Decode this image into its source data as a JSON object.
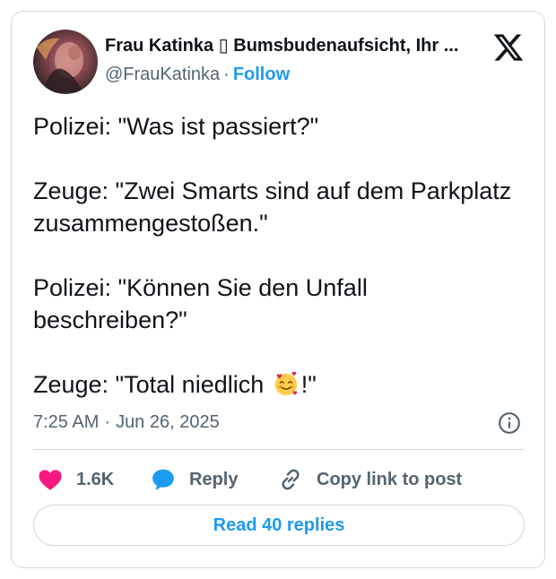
{
  "author": {
    "display_name": "Frau Katinka ▯ Bumsbudenaufsicht, Ihr ...",
    "handle": "@FrauKatinka",
    "separator": "·",
    "follow_label": "Follow",
    "avatar_icon": "profile-photo"
  },
  "platform_icon": "x-logo-icon",
  "tweet": {
    "lines": [
      "Polizei: \"Was ist passiert?\"",
      "Zeuge: \"Zwei Smarts sind auf dem Parkplatz zusammengestoßen.\"",
      "Polizei: \"Können Sie den Unfall beschreiben?\"",
      "Zeuge: \"Total niedlich",
      "!\""
    ],
    "emoji": "smiling-face-with-hearts"
  },
  "meta": {
    "time": "7:25 AM",
    "separator": "·",
    "date": "Jun 26, 2025",
    "info_icon": "info-icon"
  },
  "actions": {
    "like_count": "1.6K",
    "reply_label": "Reply",
    "copy_label": "Copy link to post"
  },
  "read_replies_label": "Read 40 replies",
  "colors": {
    "accent": "#1d9bf0",
    "like": "#f91880",
    "text": "#0f1419",
    "muted": "#536471",
    "border": "#cfd9de"
  }
}
